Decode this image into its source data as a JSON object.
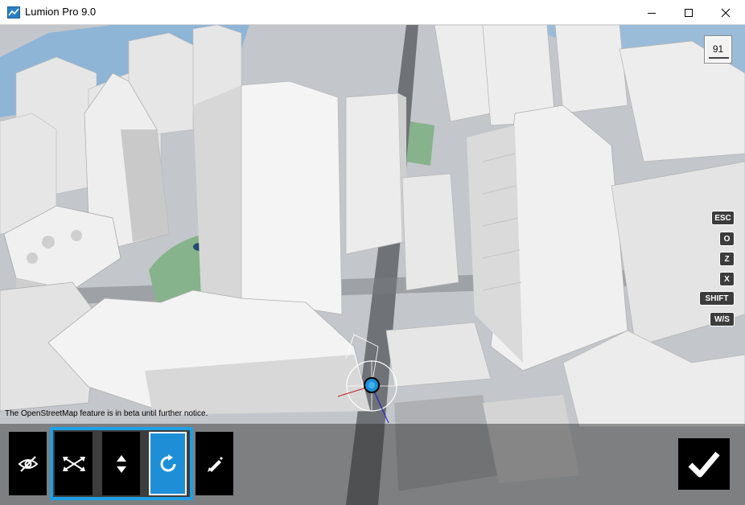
{
  "window": {
    "title": "Lumion Pro 9.0",
    "icons": [
      "lumion-app-icon",
      "minimize-icon",
      "maximize-icon",
      "close-icon"
    ]
  },
  "viewport": {
    "fps": "91",
    "notice": "The OpenStreetMap feature is in beta until further notice.",
    "shortcut_keys": [
      "ESC",
      "O",
      "Z",
      "X",
      "SHIFT",
      "W/S"
    ]
  },
  "toolbar": {
    "buttons": [
      {
        "icon": "eye-hidden-icon",
        "active": false
      },
      {
        "icon": "move-icon",
        "active": false
      },
      {
        "icon": "height-arrows-icon",
        "active": false
      },
      {
        "icon": "rotate-icon",
        "active": true
      },
      {
        "icon": "pencil-icon",
        "active": false
      }
    ],
    "confirm_icon": "checkmark-icon"
  },
  "colors": {
    "accent": "#1ea0e6",
    "active_button": "#1e8fd6",
    "toolbar_button": "#000000",
    "water": "#8fb5d6",
    "park": "#86b38b"
  }
}
